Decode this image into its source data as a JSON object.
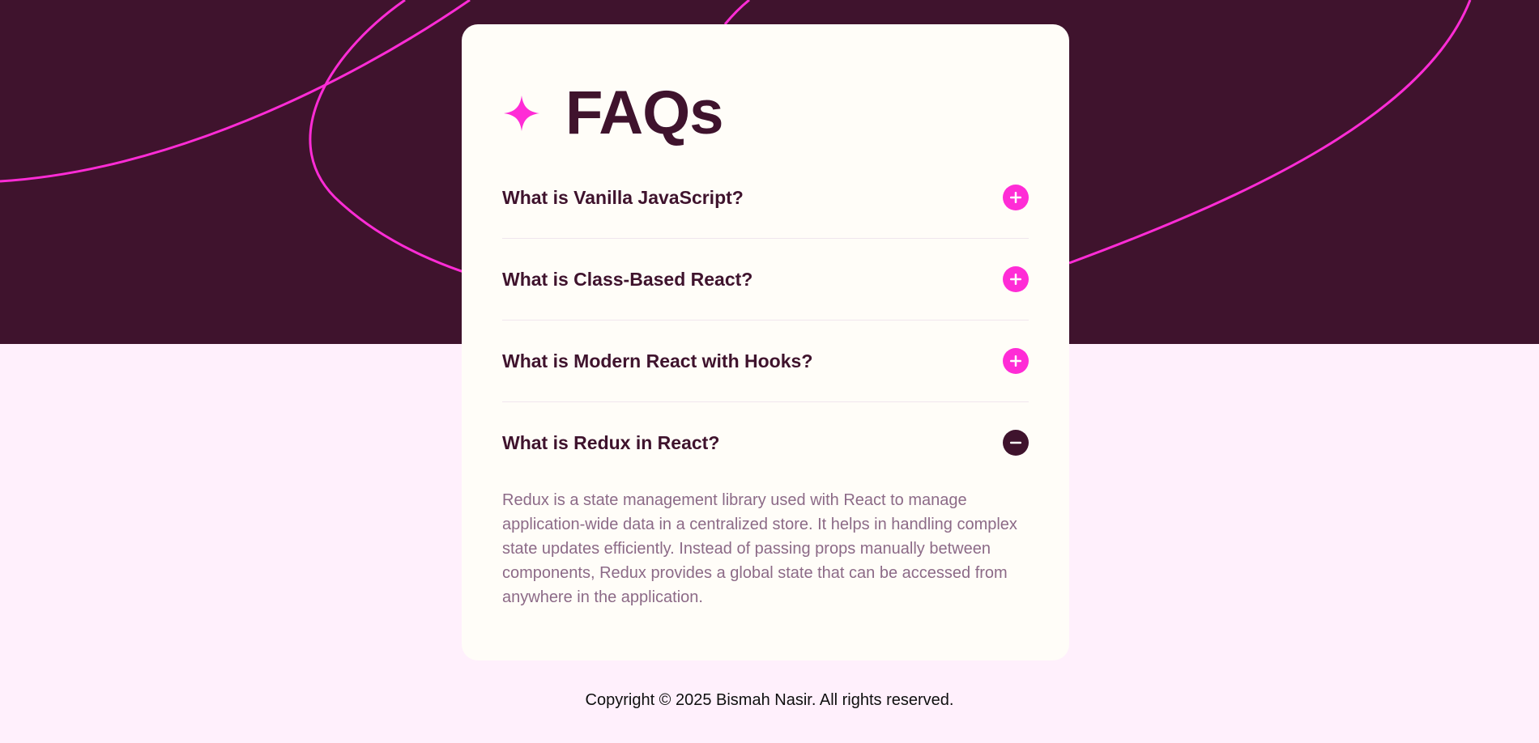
{
  "colors": {
    "dark_purple": "#3f132d",
    "accent_pink": "#ff2cd6",
    "light_pink_bg": "#fff0fc",
    "card_bg": "#fffdf8",
    "answer_text": "#8c6a87"
  },
  "header": {
    "icon": "star-icon",
    "title": "FAQs"
  },
  "faqs": [
    {
      "question": "What is Vanilla JavaScript?",
      "expanded": false,
      "icon": "plus-icon"
    },
    {
      "question": "What is Class-Based React?",
      "expanded": false,
      "icon": "plus-icon"
    },
    {
      "question": "What is Modern React with Hooks?",
      "expanded": false,
      "icon": "plus-icon"
    },
    {
      "question": "What is Redux in React?",
      "expanded": true,
      "icon": "minus-icon",
      "answer": "Redux is a state management library used with React to manage application-wide data in a centralized store. It helps in handling complex state updates efficiently. Instead of passing props manually between components, Redux provides a global state that can be accessed from anywhere in the application."
    }
  ],
  "footer": {
    "copyright": "Copyright © 2025 Bismah Nasir. All rights reserved."
  }
}
